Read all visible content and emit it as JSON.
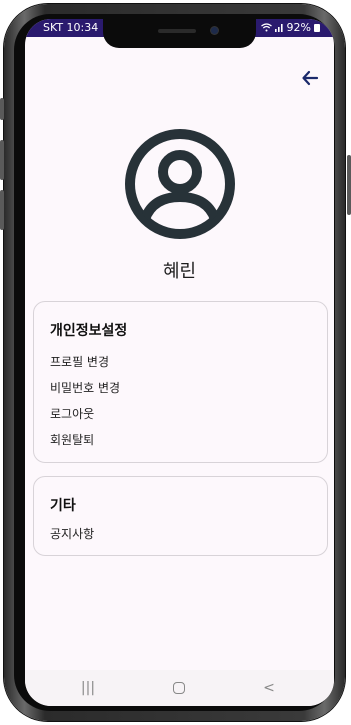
{
  "status_bar": {
    "carrier_time": "SKT 10:34",
    "battery": "92%",
    "signal_icons": "wifi-icon signal-icon"
  },
  "header": {
    "back_icon": "arrow-left-icon"
  },
  "profile": {
    "avatar_icon": "user-circle-icon",
    "name": "혜린"
  },
  "privacy_section": {
    "title": "개인정보설정",
    "items": [
      "프로필 변경",
      "비밀번호 변경",
      "로그아웃",
      "회원탈퇴"
    ]
  },
  "etc_section": {
    "title": "기타",
    "items": [
      "공지사항"
    ]
  },
  "nav_bar": {
    "recents": "|||",
    "home_icon": "home-icon",
    "back": "<"
  },
  "colors": {
    "status_bar_bg": "#2a1a6e",
    "accent": "#1b2a6b",
    "screen_bg": "#fdf8fc"
  }
}
